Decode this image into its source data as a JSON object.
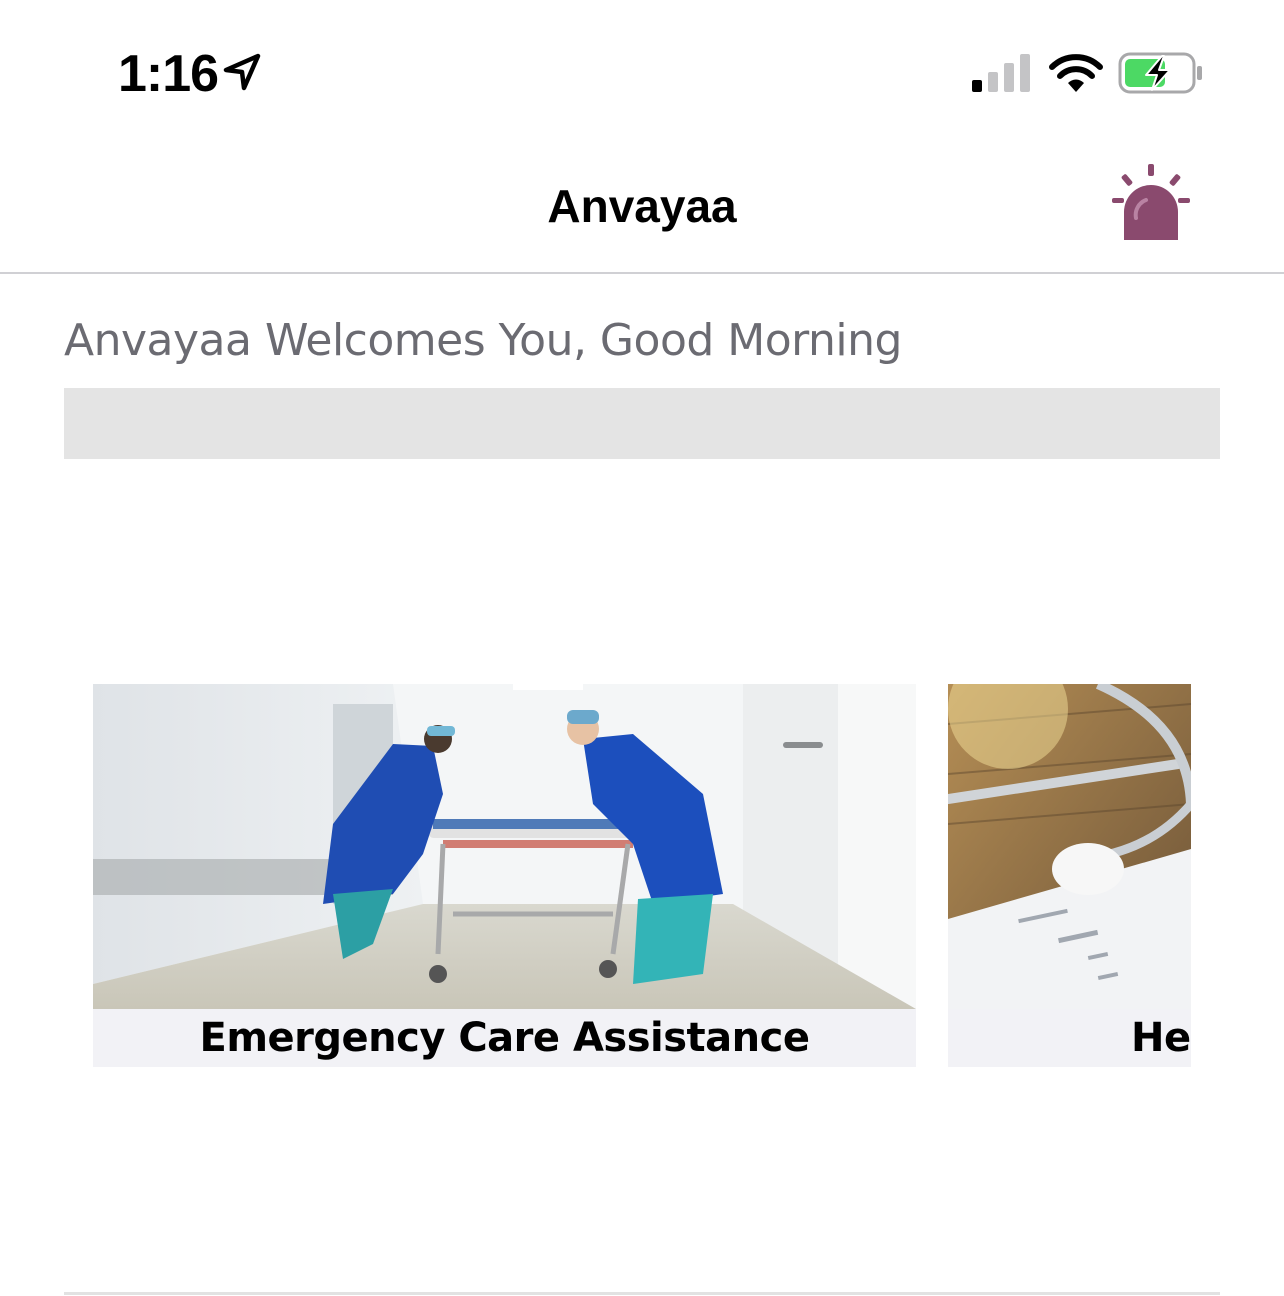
{
  "status_bar": {
    "time": "1:16",
    "icons": [
      "location-arrow-icon",
      "cellular-signal-icon",
      "wifi-icon",
      "battery-charging-icon"
    ],
    "battery_color": "#4cd964"
  },
  "nav": {
    "title": "Anvayaa",
    "alarm_icon": "emergency-alarm-icon",
    "alarm_color": "#8a4a6e"
  },
  "main": {
    "welcome_text": "Anvayaa Welcomes You, Good Morning",
    "cards": [
      {
        "label": "Emergency Care Assistance",
        "image": "hospital-stretcher-photo"
      },
      {
        "label": "Hea",
        "image": "stethoscope-lab-report-photo"
      }
    ]
  }
}
